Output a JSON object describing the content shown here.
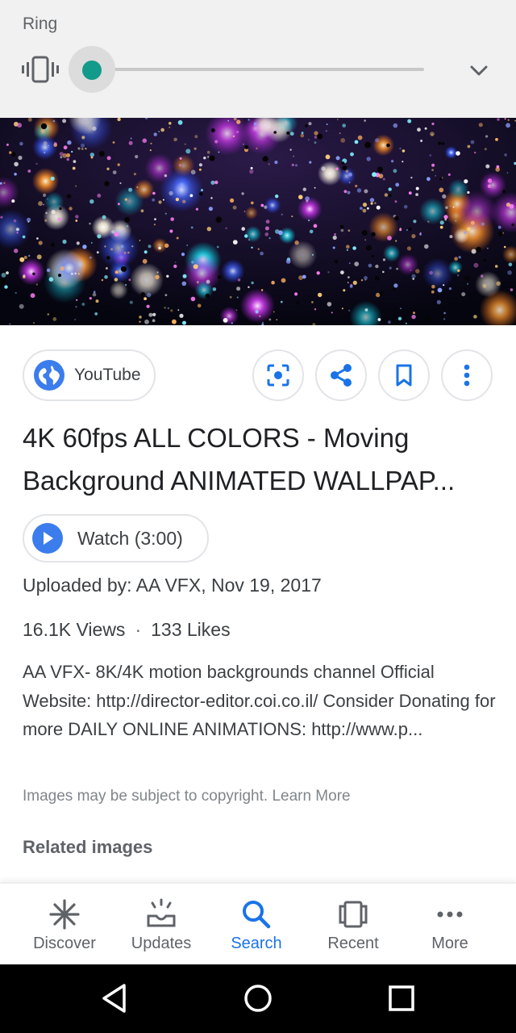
{
  "volume": {
    "label": "Ring",
    "level": 0.0,
    "mode_icon": "vibrate-icon",
    "accent_color": "#129a8a"
  },
  "result": {
    "source": {
      "label": "YouTube",
      "icon": "globe-icon"
    },
    "actions": [
      "lens-icon",
      "share-icon",
      "bookmark-icon",
      "more-vert-icon"
    ],
    "title": "4K 60fps ALL COLORS - Moving Background ANIMATED WALLPAP...",
    "watch_label": "Watch (3:00)",
    "uploaded": "Uploaded by: AA VFX, Nov 19, 2017",
    "views": "16.1K Views",
    "separator": "·",
    "likes": "133 Likes",
    "description": "AA VFX- 8K/4K motion backgrounds channel Official Website: http://director-editor.coi.co.il/ Consider Donating for more DAILY ONLINE ANIMATIONS: http://www.p...",
    "copyright": "Images may be subject to copyright.",
    "learn_more": "Learn More",
    "related": "Related images"
  },
  "bottom_nav": [
    {
      "label": "Discover",
      "icon": "discover-icon",
      "active": false
    },
    {
      "label": "Updates",
      "icon": "updates-icon",
      "active": false
    },
    {
      "label": "Search",
      "icon": "search-icon",
      "active": true
    },
    {
      "label": "Recent",
      "icon": "recent-icon",
      "active": false
    },
    {
      "label": "More",
      "icon": "more-horiz-icon",
      "active": false
    }
  ],
  "system_nav": [
    "back-icon",
    "home-icon",
    "overview-icon"
  ],
  "colors": {
    "brand_blue": "#1a73e8",
    "chip_border": "#e2e4e8"
  }
}
